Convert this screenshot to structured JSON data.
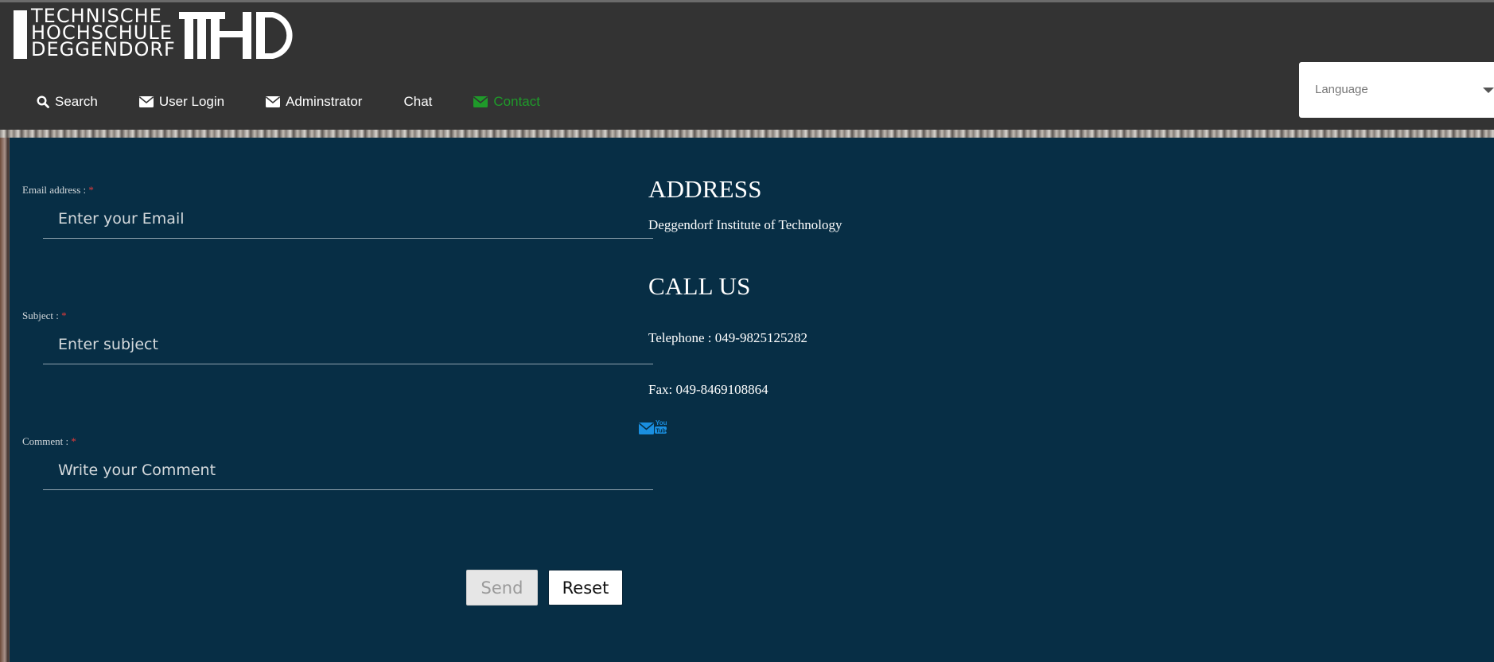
{
  "logo": {
    "lines": [
      "TECHNISCHE",
      "HOCHSCHULE",
      "DEGGENDORF"
    ],
    "mark_text": "THD"
  },
  "nav": {
    "items": [
      {
        "label": "Search",
        "icon": "search-icon"
      },
      {
        "label": "User Login",
        "icon": "envelope-icon"
      },
      {
        "label": "Adminstrator",
        "icon": "envelope-icon"
      },
      {
        "label": "Chat",
        "icon": ""
      },
      {
        "label": "Contact",
        "icon": "envelope-icon",
        "active": true
      }
    ],
    "active_color": "#1f9a2a"
  },
  "language": {
    "placeholder": "Language"
  },
  "form": {
    "email": {
      "label": "Email address :",
      "required_mark": "*",
      "placeholder": "Enter your Email"
    },
    "subject": {
      "label": "Subject :",
      "required_mark": "*",
      "placeholder": "Enter subject"
    },
    "comment": {
      "label": "Comment :",
      "required_mark": "*",
      "placeholder": "Write your Comment"
    },
    "send_label": "Send",
    "reset_label": "Reset"
  },
  "contact": {
    "address_title": "ADDRESS",
    "address_text": "Deggendorf Institute of Technology",
    "call_title": "CALL US",
    "telephone": "Telephone : 049-9825125282",
    "fax": "Fax: 049-8469108864",
    "social_icons": [
      "mail-icon",
      "youtube-icon"
    ]
  },
  "colors": {
    "header_bg": "#333333",
    "panel_bg": "#072e45",
    "required": "#e23b3b",
    "social_blue": "#1a8fe0"
  }
}
